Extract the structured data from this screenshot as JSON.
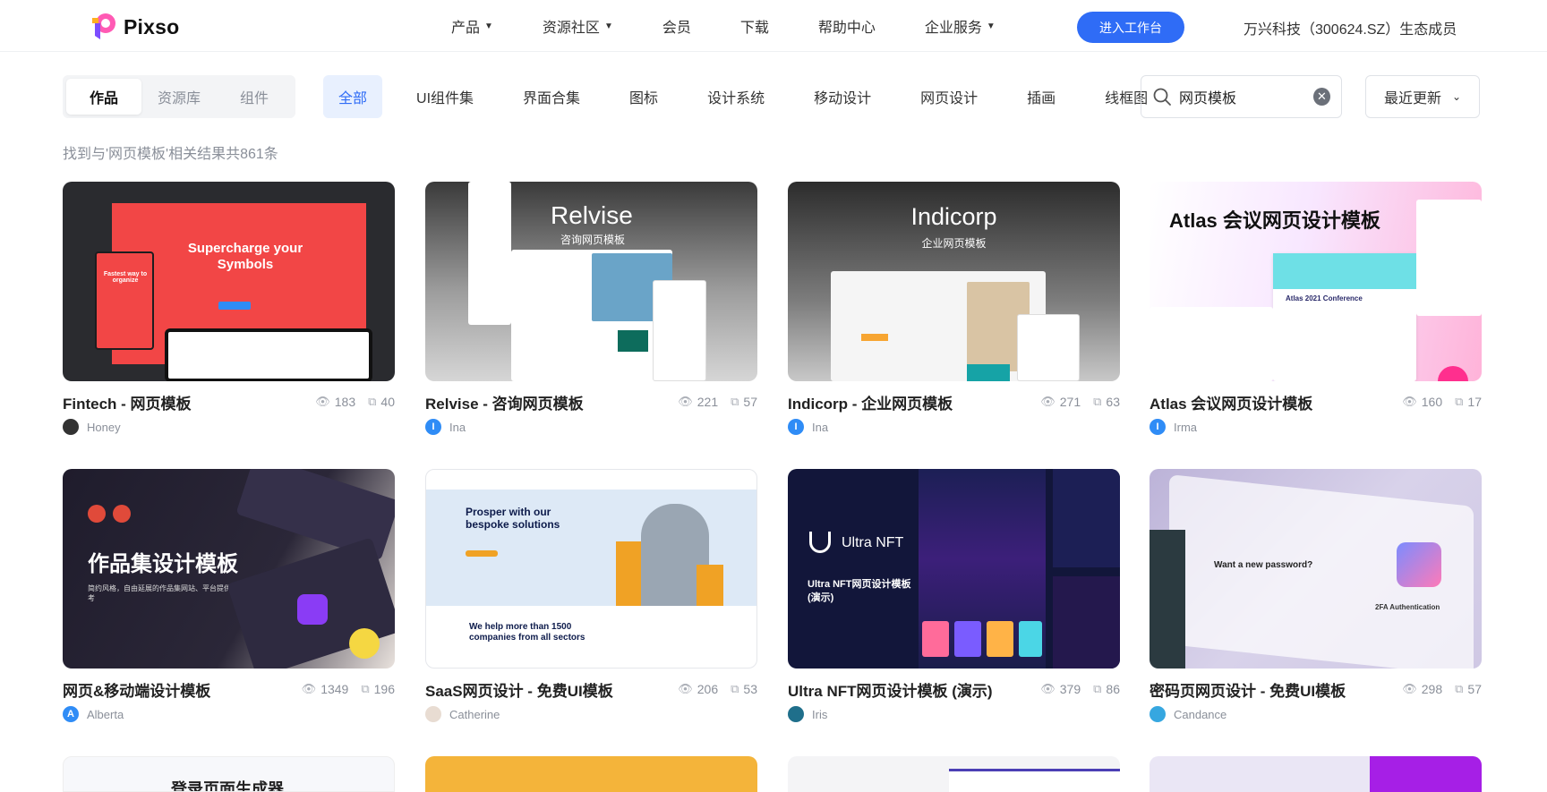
{
  "brand": {
    "name": "Pixso"
  },
  "nav": {
    "items": [
      {
        "label": "产品",
        "dropdown": true
      },
      {
        "label": "资源社区",
        "dropdown": true
      },
      {
        "label": "会员",
        "dropdown": false
      },
      {
        "label": "下载",
        "dropdown": false
      },
      {
        "label": "帮助中心",
        "dropdown": false
      },
      {
        "label": "企业服务",
        "dropdown": true
      }
    ],
    "cta": "进入工作台",
    "ecosystem": "万兴科技（300624.SZ）生态成员"
  },
  "segments": [
    "作品",
    "资源库",
    "组件"
  ],
  "active_segment": "作品",
  "categories": [
    "全部",
    "UI组件集",
    "界面合集",
    "图标",
    "设计系统",
    "移动设计",
    "网页设计",
    "插画",
    "线框图"
  ],
  "active_category": "全部",
  "search": {
    "value": "网页模板",
    "placeholder": ""
  },
  "sort": {
    "label": "最近更新"
  },
  "result_text": "找到与'网页模板'相关结果共861条",
  "cards": [
    {
      "title": "Fintech - 网页模板",
      "views": "183",
      "copies": "40",
      "author": "Honey",
      "thumb_title": "Supercharge your Symbols",
      "thumb_sub": "Fastest way to organize",
      "avatar_color": "#333333"
    },
    {
      "title": "Relvise - 咨询网页模板",
      "views": "221",
      "copies": "57",
      "author": "Ina",
      "thumb_title": "Relvise",
      "thumb_sub": "咨询网页模板",
      "avatar_color": "#2f8cf6"
    },
    {
      "title": "Indicorp - 企业网页模板",
      "views": "271",
      "copies": "63",
      "author": "Ina",
      "thumb_title": "Indicorp",
      "thumb_sub": "企业网页模板",
      "avatar_color": "#2f8cf6"
    },
    {
      "title": "Atlas 会议网页设计模板",
      "views": "160",
      "copies": "17",
      "author": "Irma",
      "thumb_title": "Atlas 会议网页设计模板",
      "thumb_sub": "Atlas 2021 Conference",
      "avatar_color": "#2f8cf6"
    },
    {
      "title": "网页&移动端设计模板",
      "views": "1349",
      "copies": "196",
      "author": "Alberta",
      "thumb_title": "作品集设计模板",
      "thumb_sub": "简约风格，自由延展的作品集网站、平台提供参考",
      "avatar_color": "#2f8cf6"
    },
    {
      "title": "SaaS网页设计 - 免费UI模板",
      "views": "206",
      "copies": "53",
      "author": "Catherine",
      "thumb_title": "Prosper with our bespoke solutions",
      "thumb_sub": "We help more than 1500 companies from all sectors",
      "avatar_color": "#c9a78e"
    },
    {
      "title": "Ultra NFT网页设计模板 (演示)",
      "views": "379",
      "copies": "86",
      "author": "Iris",
      "thumb_title": "Ultra NFT",
      "thumb_sub": "Ultra NFT网页设计模板 (演示)",
      "avatar_color": "#1f6f8b"
    },
    {
      "title": "密码页网页设计 - 免费UI模板",
      "views": "298",
      "copies": "57",
      "author": "Candance",
      "thumb_title": "Want a new password?",
      "thumb_sub": "2FA Authentication",
      "avatar_color": "#36a7e0"
    }
  ],
  "row3_peek": [
    {
      "thumb_title": "登录页面生成器"
    }
  ],
  "icons": {
    "view": "eye-icon",
    "copy": "copy-icon",
    "search": "search-icon",
    "clear": "clear-icon"
  }
}
